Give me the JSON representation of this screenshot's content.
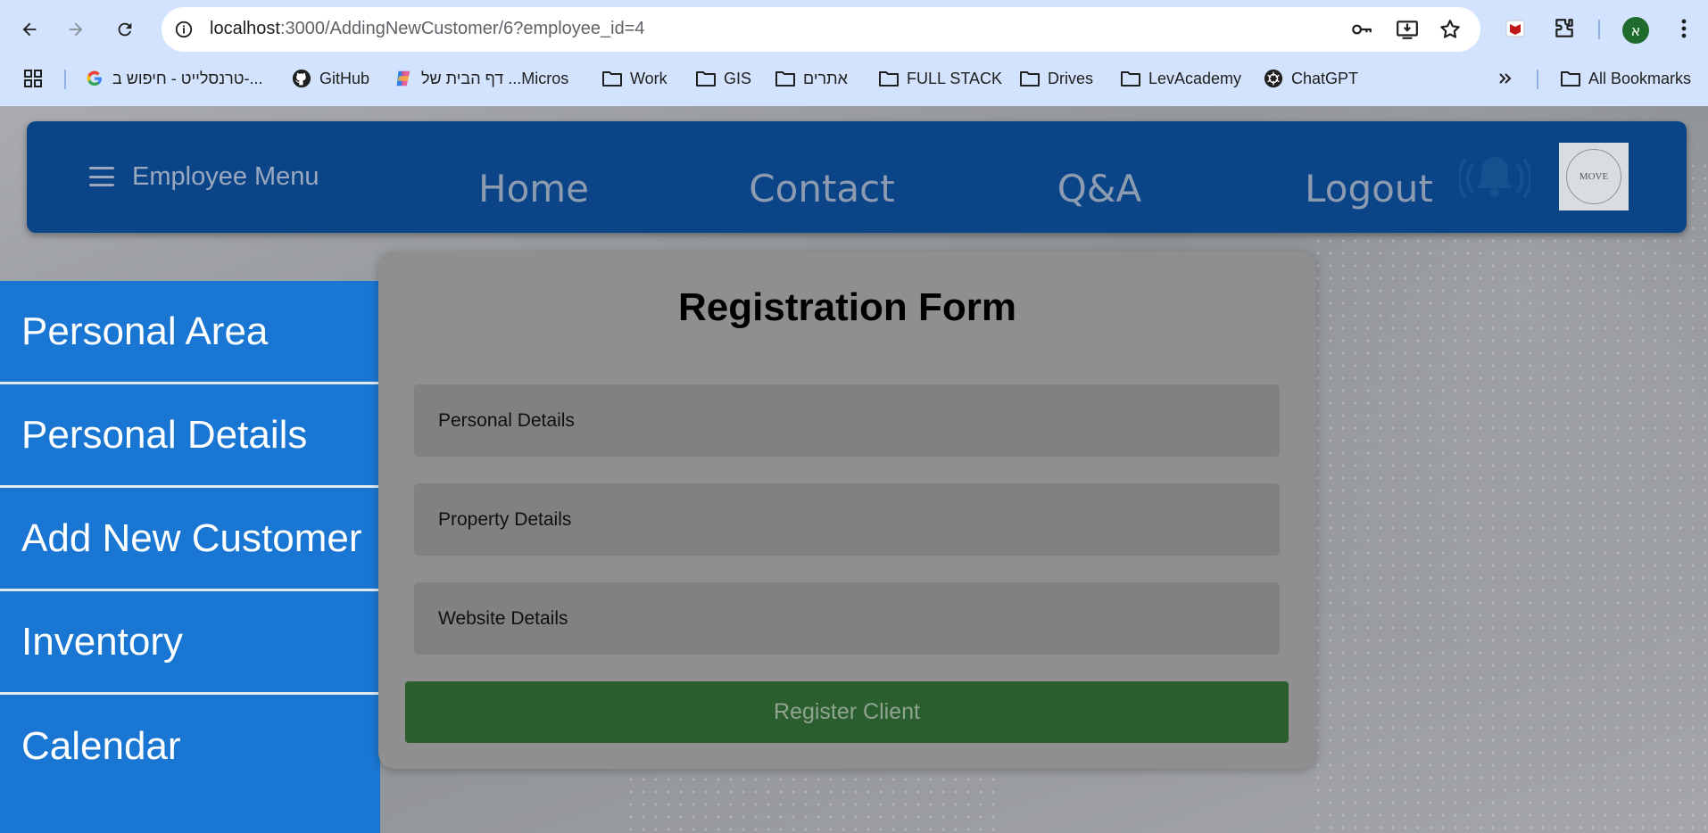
{
  "browser": {
    "url_host": "localhost",
    "url_path": ":3000/AddingNewCustomer/6?employee_id=4",
    "profile_initial": "א",
    "bookmarks": [
      {
        "label": "טרנסלייט - חיפוש ב-...",
        "icon": "google-icon"
      },
      {
        "label": "GitHub",
        "icon": "github-icon"
      },
      {
        "label": "דף הבית של ...Micros",
        "icon": "copilot-icon"
      },
      {
        "label": "Work",
        "icon": "folder-icon"
      },
      {
        "label": "GIS",
        "icon": "folder-icon"
      },
      {
        "label": "אתרים",
        "icon": "folder-icon"
      },
      {
        "label": "FULL STACK",
        "icon": "folder-icon"
      },
      {
        "label": "Drives",
        "icon": "folder-icon"
      },
      {
        "label": "LevAcademy",
        "icon": "folder-icon"
      },
      {
        "label": "ChatGPT",
        "icon": "chatgpt-icon"
      }
    ],
    "all_bookmarks": "All Bookmarks"
  },
  "header": {
    "menu_label": "Employee Menu",
    "nav": [
      "Home",
      "Contact",
      "Q&A",
      "Logout"
    ],
    "logo_text": "MOVE"
  },
  "sidebar": {
    "items": [
      "Personal Area",
      "Personal Details",
      "Add New Customer",
      "Inventory",
      "Calendar"
    ]
  },
  "form": {
    "title": "Registration Form",
    "sections": [
      "Personal Details",
      "Property Details",
      "Website Details"
    ],
    "submit_label": "Register Client"
  },
  "colors": {
    "header_bg": "#0b4587",
    "sidebar_bg": "#1976d2",
    "submit_bg": "#2b5e2e",
    "chrome_bg": "#d3e3fd"
  }
}
